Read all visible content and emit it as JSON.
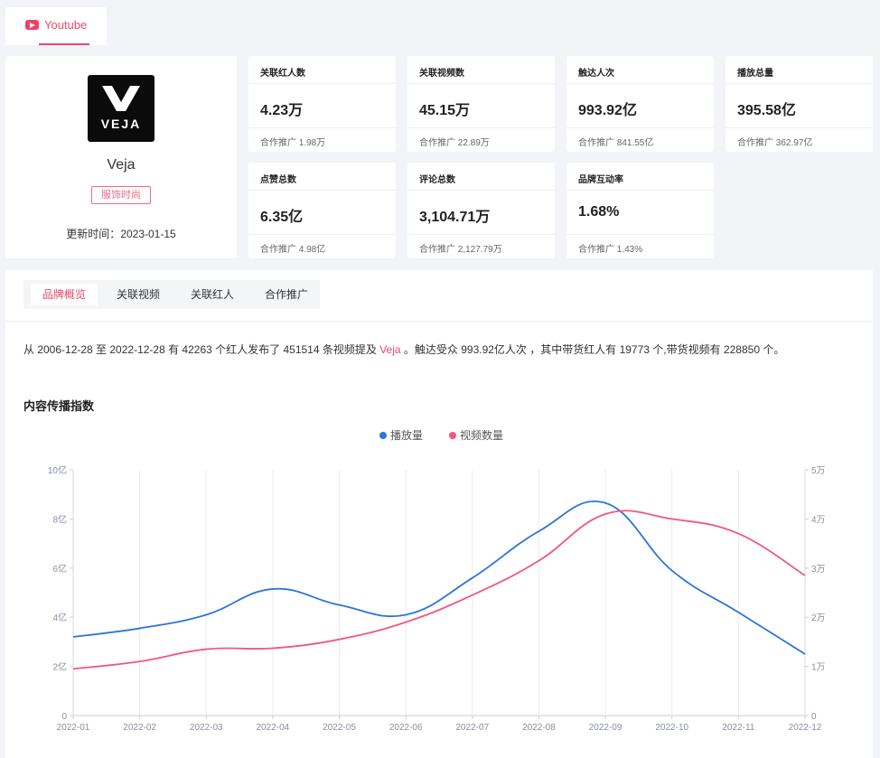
{
  "platform_tab": {
    "label": "Youtube"
  },
  "brand": {
    "logo_text": "VEJA",
    "name": "Veja",
    "tag": "服饰时尚",
    "update_label": "更新时间：",
    "update_date": "2023-01-15"
  },
  "stats": [
    {
      "label": "关联红人数",
      "value": "4.23万",
      "sub_label": "合作推广",
      "sub_value": "1.98万"
    },
    {
      "label": "关联视频数",
      "value": "45.15万",
      "sub_label": "合作推广",
      "sub_value": "22.89万"
    },
    {
      "label": "触达人次",
      "value": "993.92亿",
      "sub_label": "合作推广",
      "sub_value": "841.55亿"
    },
    {
      "label": "播放总量",
      "value": "395.58亿",
      "sub_label": "合作推广",
      "sub_value": "362.97亿"
    },
    {
      "label": "点赞总数",
      "value": "6.35亿",
      "sub_label": "合作推广",
      "sub_value": "4.98亿"
    },
    {
      "label": "评论总数",
      "value": "3,104.71万",
      "sub_label": "合作推广",
      "sub_value": "2,127.79万"
    },
    {
      "label": "品牌互动率",
      "value": "1.68%",
      "sub_label": "合作推广",
      "sub_value": "1.43%"
    }
  ],
  "tabs": [
    {
      "label": "品牌概览",
      "active": true
    },
    {
      "label": "关联视频",
      "active": false
    },
    {
      "label": "关联红人",
      "active": false
    },
    {
      "label": "合作推广",
      "active": false
    }
  ],
  "summary": {
    "p1": "从 2006-12-28 至 2022-12-28 有 42263 个红人发布了 451514 条视频提及 ",
    "brand": "Veja",
    "p2": " 。触达受众 993.92亿人次 ，其中带货红人有 19773 个,带货视频有 228850 个。"
  },
  "section_title": "内容传播指数",
  "colors": {
    "accent": "#e84a6a",
    "series_play": "#2f74d8",
    "series_video": "#f0587e"
  },
  "chart_data": {
    "type": "line",
    "categories": [
      "2022-01",
      "2022-02",
      "2022-03",
      "2022-04",
      "2022-05",
      "2022-06",
      "2022-07",
      "2022-08",
      "2022-09",
      "2022-10",
      "2022-11",
      "2022-12"
    ],
    "series": [
      {
        "name": "播放量",
        "axis": "left",
        "values": [
          3.2,
          3.55,
          4.1,
          5.15,
          4.5,
          4.1,
          5.6,
          7.5,
          8.65,
          5.9,
          4.2,
          2.5
        ]
      },
      {
        "name": "视频数量",
        "axis": "right",
        "values": [
          9500,
          11000,
          13500,
          13700,
          15500,
          19000,
          24500,
          31500,
          41000,
          40000,
          37000,
          28500
        ]
      }
    ],
    "y_left": {
      "ticks": [
        0,
        2,
        4,
        6,
        8,
        10
      ],
      "tick_labels": [
        "0",
        "2亿",
        "4亿",
        "6亿",
        "8亿",
        "10亿"
      ],
      "range": [
        0,
        10
      ]
    },
    "y_right": {
      "ticks": [
        0,
        10000,
        20000,
        30000,
        40000,
        50000
      ],
      "tick_labels": [
        "0",
        "1万",
        "2万",
        "3万",
        "4万",
        "5万"
      ],
      "range": [
        0,
        50000
      ]
    },
    "grid": true,
    "legend": "top-center"
  }
}
